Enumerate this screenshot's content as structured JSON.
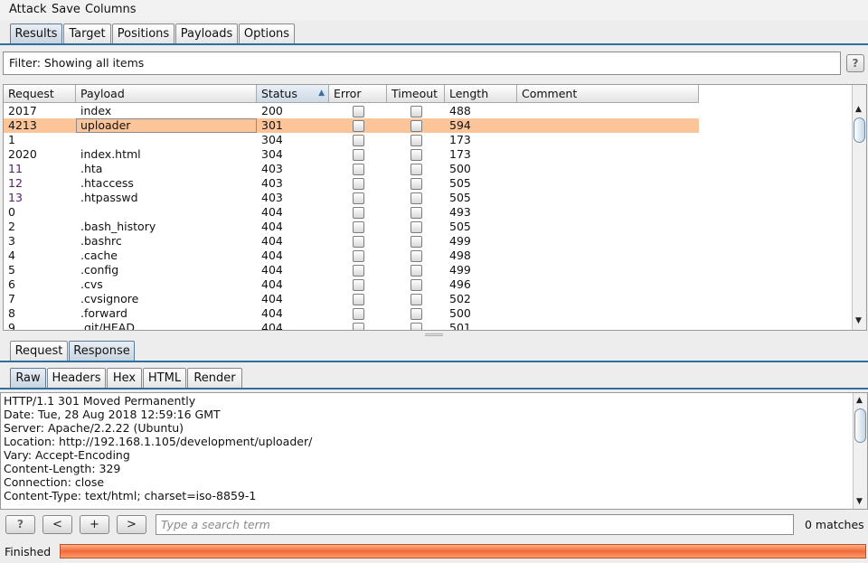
{
  "menu": [
    "Attack",
    "Save",
    "Columns"
  ],
  "main_tabs": [
    "Results",
    "Target",
    "Positions",
    "Payloads",
    "Options"
  ],
  "active_main_tab": "Results",
  "filter": {
    "text": "Filter: Showing all items",
    "help_label": "?"
  },
  "table": {
    "columns": [
      "Request",
      "Payload",
      "Status",
      "Error",
      "Timeout",
      "Length",
      "Comment"
    ],
    "sorted_column": "Status",
    "rows": [
      {
        "request": "2017",
        "payload": "index",
        "status": "200",
        "length": "488"
      },
      {
        "request": "4213",
        "payload": "uploader",
        "status": "301",
        "length": "594",
        "selected": true
      },
      {
        "request": "1",
        "payload": "",
        "status": "304",
        "length": "173"
      },
      {
        "request": "2020",
        "payload": "index.html",
        "status": "304",
        "length": "173"
      },
      {
        "request": "11",
        "payload": ".hta",
        "status": "403",
        "length": "500"
      },
      {
        "request": "12",
        "payload": ".htaccess",
        "status": "403",
        "length": "505"
      },
      {
        "request": "13",
        "payload": ".htpasswd",
        "status": "403",
        "length": "505"
      },
      {
        "request": "0",
        "payload": "",
        "status": "404",
        "length": "493"
      },
      {
        "request": "2",
        "payload": ".bash_history",
        "status": "404",
        "length": "505"
      },
      {
        "request": "3",
        "payload": ".bashrc",
        "status": "404",
        "length": "499"
      },
      {
        "request": "4",
        "payload": ".cache",
        "status": "404",
        "length": "498"
      },
      {
        "request": "5",
        "payload": ".config",
        "status": "404",
        "length": "499"
      },
      {
        "request": "6",
        "payload": ".cvs",
        "status": "404",
        "length": "496"
      },
      {
        "request": "7",
        "payload": ".cvsignore",
        "status": "404",
        "length": "502"
      },
      {
        "request": "8",
        "payload": ".forward",
        "status": "404",
        "length": "500"
      },
      {
        "request": "9",
        "payload": ".git/HEAD",
        "status": "404",
        "length": "501"
      }
    ]
  },
  "detail_tabs": [
    "Request",
    "Response"
  ],
  "active_detail_tab": "Response",
  "view_tabs": [
    "Raw",
    "Headers",
    "Hex",
    "HTML",
    "Render"
  ],
  "active_view_tab": "Raw",
  "response_lines": [
    "HTTP/1.1 301 Moved Permanently",
    "Date: Tue, 28 Aug 2018 12:59:16 GMT",
    "Server: Apache/2.2.22 (Ubuntu)",
    "Location: http://192.168.1.105/development/uploader/",
    "Vary: Accept-Encoding",
    "Content-Length: 329",
    "Connection: close",
    "Content-Type: text/html; charset=iso-8859-1"
  ],
  "search": {
    "help_label": "?",
    "prev_label": "<",
    "add_label": "+",
    "next_label": ">",
    "placeholder": "Type a search term",
    "matches": "0 matches"
  },
  "status": {
    "text": "Finished",
    "progress": 1.0
  },
  "colors": {
    "selected_row": "#fcc499",
    "progress": "#f06b38",
    "tab_underline": "#2d6f9e"
  }
}
